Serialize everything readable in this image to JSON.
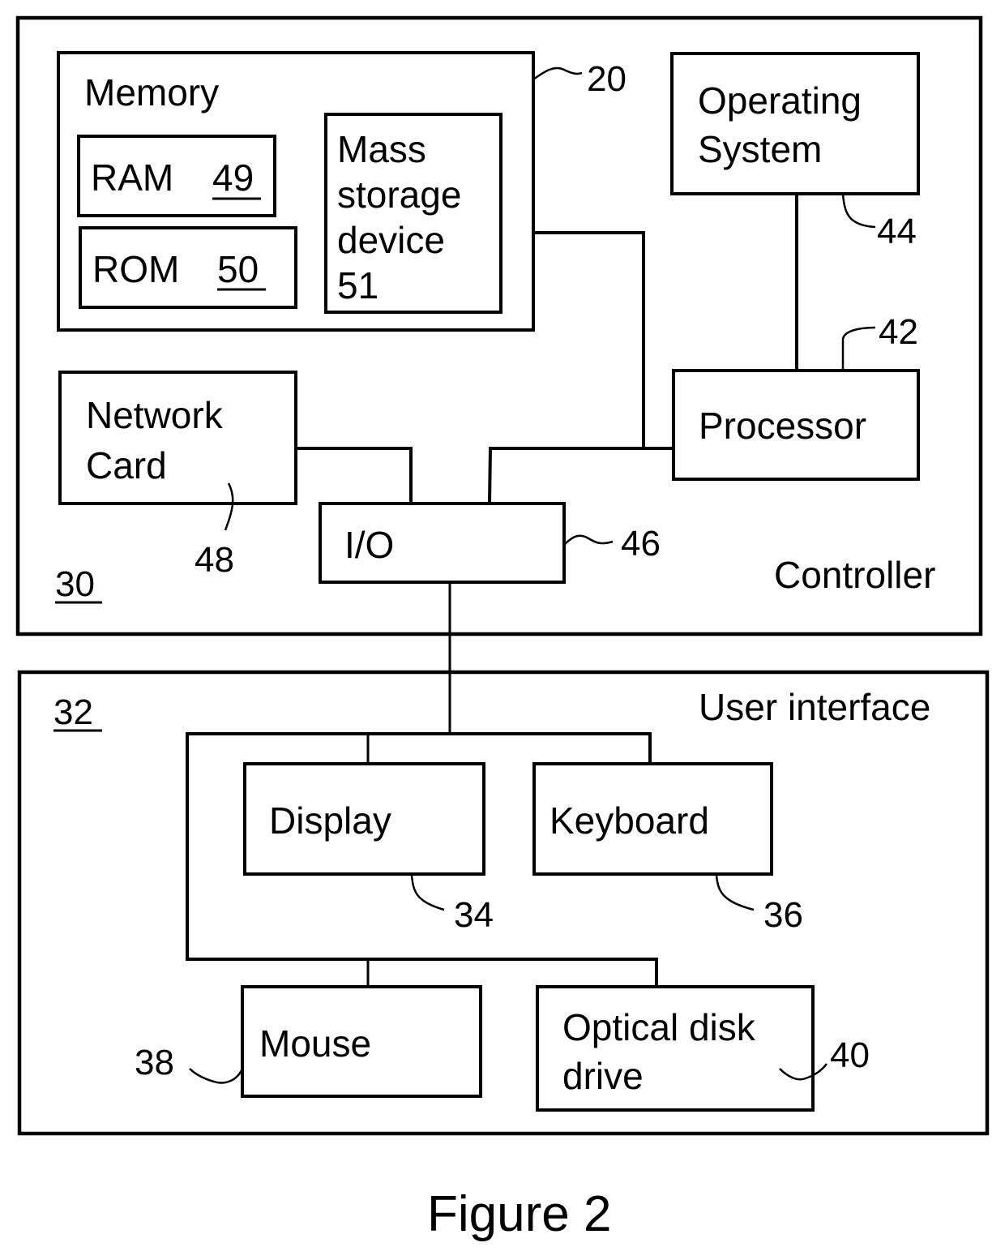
{
  "figure": {
    "caption": "Figure 2"
  },
  "controller": {
    "label": "Controller",
    "ref": "30",
    "memory": {
      "label": "Memory",
      "ref": "20",
      "ram": {
        "label": "RAM",
        "ref": "49"
      },
      "rom": {
        "label": "ROM",
        "ref": "50"
      },
      "mass_storage": {
        "lines": [
          "Mass",
          "storage",
          "device",
          "51"
        ]
      }
    },
    "operating_system": {
      "lines": [
        "Operating",
        "System"
      ],
      "ref": "44"
    },
    "processor": {
      "label": "Processor",
      "ref": "42"
    },
    "network_card": {
      "lines": [
        "Network",
        "Card"
      ],
      "ref": "48"
    },
    "io": {
      "label": "I/O",
      "ref": "46"
    }
  },
  "user_interface": {
    "label": "User interface",
    "ref": "32",
    "display": {
      "label": "Display",
      "ref": "34"
    },
    "keyboard": {
      "label": "Keyboard",
      "ref": "36"
    },
    "mouse": {
      "label": "Mouse",
      "ref": "38"
    },
    "optical_drive": {
      "lines": [
        "Optical disk",
        "drive"
      ],
      "ref": "40"
    }
  }
}
